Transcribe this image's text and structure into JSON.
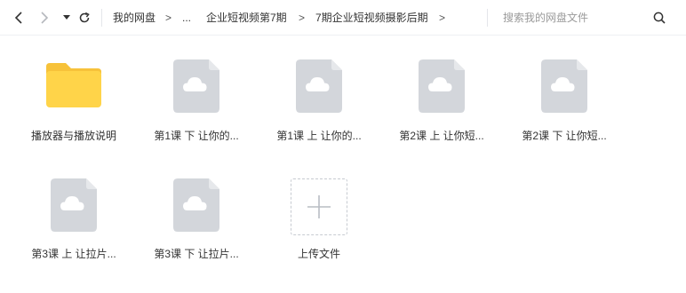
{
  "toolbar": {
    "icons": {
      "back": "chevron-left-icon",
      "forward": "chevron-right-icon",
      "history": "caret-down-icon",
      "refresh": "refresh-icon",
      "search": "search-icon"
    },
    "breadcrumb": [
      {
        "label": "我的网盘"
      },
      {
        "label": "..."
      },
      {
        "label": "企业短视频第7期"
      },
      {
        "label": "7期企业短视频摄影后期"
      }
    ],
    "separator": ">",
    "search_placeholder": "搜索我的网盘文件"
  },
  "items": [
    {
      "type": "folder",
      "name": "播放器与播放说明",
      "icon": "folder-icon"
    },
    {
      "type": "file",
      "name": "第1课  下 让你的...",
      "icon": "cloud-file-icon"
    },
    {
      "type": "file",
      "name": "第1课 上  让你的...",
      "icon": "cloud-file-icon"
    },
    {
      "type": "file",
      "name": "第2课  上 让你短...",
      "icon": "cloud-file-icon"
    },
    {
      "type": "file",
      "name": "第2课   下 让你短...",
      "icon": "cloud-file-icon"
    },
    {
      "type": "file",
      "name": "第3课  上 让拉片...",
      "icon": "cloud-file-icon"
    },
    {
      "type": "file",
      "name": "第3课  下 让拉片...",
      "icon": "cloud-file-icon"
    },
    {
      "type": "upload",
      "name": "上传文件",
      "icon": "plus-icon"
    }
  ],
  "colors": {
    "folder": "#FFD449",
    "folder_back": "#F7C23A",
    "file": "#D3D6DB",
    "file_fold": "#E6E8EB",
    "cloud": "#FFFFFF",
    "upload_border": "#C7CBD1",
    "plus": "#B9BDC4"
  }
}
